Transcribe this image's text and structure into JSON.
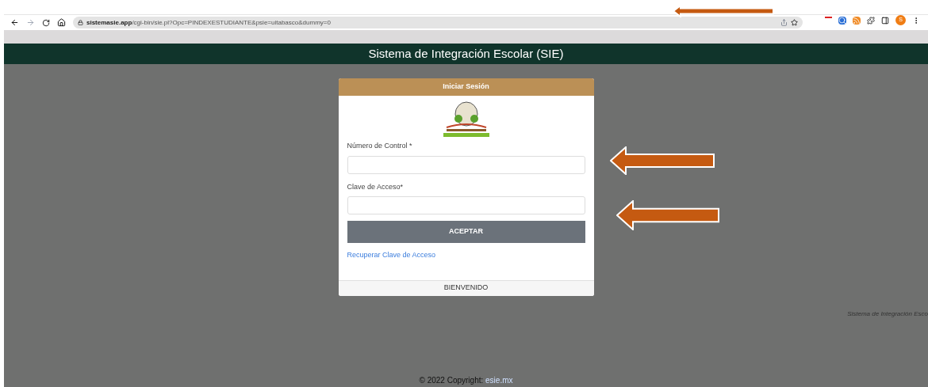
{
  "browser": {
    "url_host": "sistemasie.app",
    "url_path": "/cgi-bin/sie.pl?Opc=PINDEXESTUDIANTE&psie=uitabasco&dummy=0",
    "profile_initial": "S"
  },
  "header": {
    "title": "Sistema de Integración Escolar (SIE)"
  },
  "login": {
    "title": "Iniciar Sesión",
    "fields": [
      {
        "label": "Número de Control *"
      },
      {
        "label": "Clave de Acceso*"
      }
    ],
    "button": "ACEPTAR",
    "link": "Recuperar Clave de Acceso",
    "footer": "BIENVENIDO"
  },
  "side_text": "Sistema de Integración Esco",
  "copyright": {
    "text": "© 2022 Copyright: ",
    "link": "esie.mx"
  }
}
